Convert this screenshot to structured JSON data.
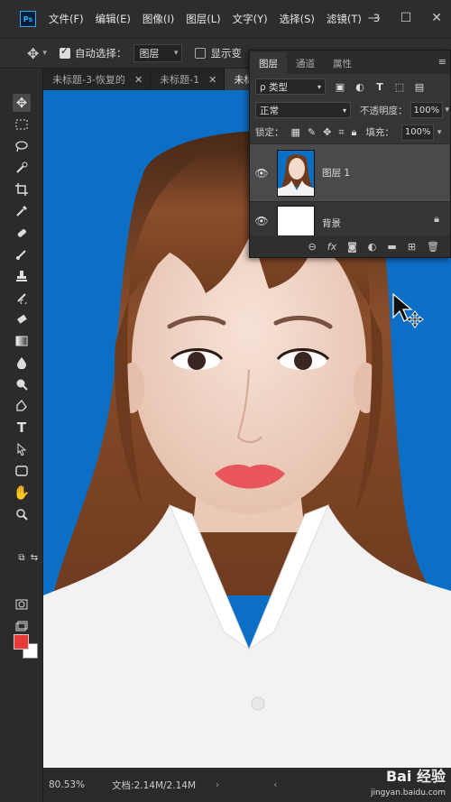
{
  "app": {
    "logo": "Ps"
  },
  "menu": [
    "文件(F)",
    "编辑(E)",
    "图像(I)",
    "图层(L)",
    "文字(Y)",
    "选择(S)",
    "滤镜(T)",
    "3"
  ],
  "window_controls": {
    "minimize": "—",
    "maximize": "☐",
    "close": "✕"
  },
  "options": {
    "auto_select_label": "自动选择：",
    "auto_select_value": "图层",
    "show_transform_label": "显示变"
  },
  "tabs": [
    {
      "label": "未标题-3-恢复的",
      "close": "✕"
    },
    {
      "label": "未标题-1",
      "close": "✕"
    },
    {
      "label": "未标",
      "close": ""
    }
  ],
  "layers_panel": {
    "tabs": [
      "图层",
      "通道",
      "属性"
    ],
    "filter_label": "ρ 类型",
    "blend_mode": "正常",
    "opacity_label": "不透明度：",
    "opacity_value": "100%",
    "lock_label": "锁定：",
    "fill_label": "填充：",
    "fill_value": "100%",
    "layers": [
      {
        "name": "图层 1",
        "selected": true,
        "visible": true
      },
      {
        "name": "背景",
        "selected": false,
        "visible": true,
        "locked": true
      }
    ],
    "footer_fx": "fx"
  },
  "status": {
    "zoom": "80.53%",
    "doc_info": "文档:2.14M/2.14M",
    "arrow_left": "‹",
    "arrow_right": "›"
  },
  "watermark": {
    "brand": "Bai 经验",
    "url": "jingyan.baidu.com"
  },
  "colors": {
    "foreground": "#e93a36",
    "background": "#ffffff",
    "canvas_bg": "#0c6fc6"
  },
  "tools": [
    "move-icon",
    "marquee-icon",
    "lasso-icon",
    "quick-select-icon",
    "crop-icon",
    "eyedropper-icon",
    "healing-icon",
    "brush-icon",
    "stamp-icon",
    "history-brush-icon",
    "eraser-icon",
    "gradient-icon",
    "blur-icon",
    "dodge-icon",
    "pen-icon",
    "type-icon",
    "path-select-icon",
    "shape-icon",
    "hand-icon",
    "zoom-icon"
  ]
}
